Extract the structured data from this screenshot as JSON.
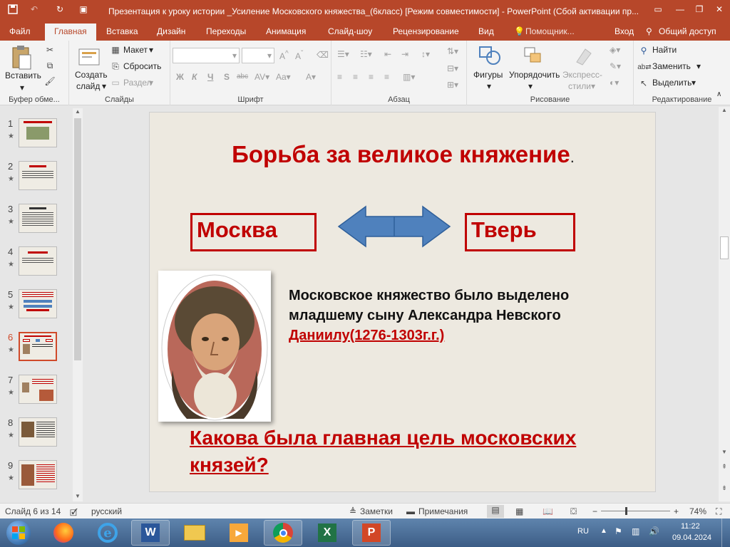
{
  "window": {
    "title": "Презентация к уроку истории _Усиление Московского княжества_(6класс) [Режим совместимости] - PowerPoint (Сбой активации пр..."
  },
  "tabs": [
    {
      "label": "Файл"
    },
    {
      "label": "Главная"
    },
    {
      "label": "Вставка"
    },
    {
      "label": "Дизайн"
    },
    {
      "label": "Переходы"
    },
    {
      "label": "Анимация"
    },
    {
      "label": "Слайд-шоу"
    },
    {
      "label": "Рецензирование"
    },
    {
      "label": "Вид"
    },
    {
      "label": "Помощник..."
    },
    {
      "label": "Вход"
    },
    {
      "label": "Общий доступ"
    }
  ],
  "ribbon": {
    "clipboard": {
      "paste": "Вставить",
      "group": "Буфер обме..."
    },
    "slides": {
      "new_slide": "Создать",
      "new_slide2": "слайд",
      "layout": "Макет",
      "reset": "Сбросить",
      "section": "Раздел",
      "group": "Слайды"
    },
    "font": {
      "font_size_value": "",
      "font_name_value": "",
      "bold": "Ж",
      "italic": "К",
      "underline": "Ч",
      "shadow": "S",
      "strike": "abc",
      "group": "Шрифт"
    },
    "paragraph": {
      "group": "Абзац"
    },
    "drawing": {
      "shapes": "Фигуры",
      "arrange": "Упорядочить",
      "quick_styles": "Экспресс-",
      "quick_styles2": "стили",
      "group": "Рисование"
    },
    "editing": {
      "find": "Найти",
      "replace": "Заменить",
      "select": "Выделить",
      "group": "Редактирование"
    }
  },
  "thumbnails": [
    {
      "num": "1"
    },
    {
      "num": "2"
    },
    {
      "num": "3"
    },
    {
      "num": "4"
    },
    {
      "num": "5"
    },
    {
      "num": "6"
    },
    {
      "num": "7"
    },
    {
      "num": "8"
    },
    {
      "num": "9"
    }
  ],
  "slide": {
    "title": "Борьба за великое княжение",
    "title_suffix": ".",
    "left_box": "Москва",
    "right_box": "Тверь",
    "body_line1": "Московское княжество было выделено",
    "body_line2": "младшему сыну Александра Невского",
    "body_link": "Даниилу(1276-1303г.г.)",
    "question": "Какова была главная цель московских князей?"
  },
  "statusbar": {
    "slide_info": "Слайд 6 из 14",
    "language": "русский",
    "notes": "Заметки",
    "comments": "Примечания",
    "zoom": "74%"
  },
  "taskbar": {
    "lang": "RU",
    "time": "11:22",
    "date": "09.04.2024"
  },
  "colors": {
    "accent": "#b7472a",
    "slide_red": "#c00000",
    "arrow_blue": "#4f81bd"
  }
}
